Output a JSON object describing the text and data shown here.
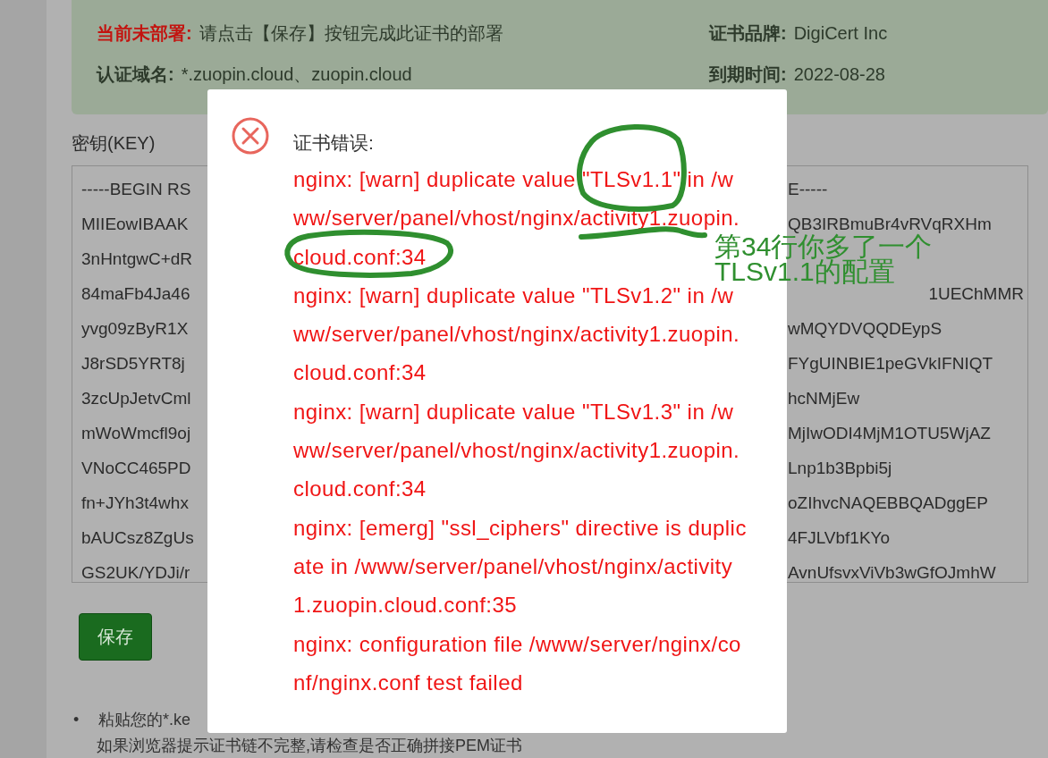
{
  "banner": {
    "status_label": "当前未部署:",
    "status_text": "请点击【保存】按钮完成此证书的部署",
    "domain_label": "认证域名:",
    "domain_value": "*.zuopin.cloud、zuopin.cloud",
    "brand_label": "证书品牌:",
    "brand_value": "DigiCert Inc",
    "expiry_label": "到期时间:",
    "expiry_value": "2022-08-28"
  },
  "key_label": "密钥(KEY)",
  "key_lines": [
    {
      "left": "-----BEGIN RS",
      "right": "E-----"
    },
    {
      "left": "MIIEowIBAAK",
      "right": "QB3IRBmuBr4vRVqRXHm"
    },
    {
      "left": "3nHntgwC+dR"
    },
    {
      "left": "84maFb4Ja46",
      "right": "1UEChMMR",
      "kind": "tail"
    },
    {
      "left": "yvg09zByR1X",
      "right": "wMQYDVQQDEypS"
    },
    {
      "left": "J8rSD5YRT8j",
      "right": "FYgUINBIE1peGVkIFNIQT"
    },
    {
      "left": "3zcUpJetvCml",
      "right": "hcNMjEw"
    },
    {
      "left": "mWoWmcfl9oj",
      "right": "MjIwODI4MjM1OTU5WjAZ"
    },
    {
      "left": "VNoCC465PD",
      "right": "Lnp1b3Bpbi5j"
    },
    {
      "left": "fn+JYh3t4whx",
      "right": "oZIhvcNAQEBBQADggEP"
    },
    {
      "left": "bAUCsz8ZgUs",
      "right": "4FJLVbf1KYo"
    },
    {
      "left": "GS2UK/YDJi/r",
      "right": "AvnUfsvxViVb3wGfOJmhW"
    }
  ],
  "save_button": "保存",
  "tips": [
    {
      "bullet": "•",
      "text": "粘贴您的*.ke"
    },
    {
      "text": "如果浏览器提示证书链不完整,请检查是否正确拼接PEM证书"
    }
  ],
  "dialog": {
    "title": "证书错误:",
    "messages": [
      {
        "lines": [
          "nginx: [warn] duplicate value \"TLSv1.1\" in /w",
          "ww/server/panel/vhost/nginx/activity1.zuopin.",
          "cloud.conf:34"
        ]
      },
      {
        "lines": [
          "nginx: [warn] duplicate value \"TLSv1.2\" in /w",
          "ww/server/panel/vhost/nginx/activity1.zuopin.",
          "cloud.conf:34"
        ]
      },
      {
        "lines": [
          "nginx: [warn] duplicate value \"TLSv1.3\" in /w",
          "ww/server/panel/vhost/nginx/activity1.zuopin.",
          "cloud.conf:34"
        ]
      },
      {
        "lines": [
          "nginx: [emerg] \"ssl_ciphers\" directive is duplic",
          "ate in /www/server/panel/vhost/nginx/activity",
          "1.zuopin.cloud.conf:35"
        ]
      },
      {
        "lines": [
          "nginx: configuration file /www/server/nginx/co",
          "nf/nginx.conf test failed"
        ]
      }
    ]
  },
  "annotation": {
    "lines": [
      "第34行你多了一个",
      "TLSv1.1的配置"
    ]
  }
}
